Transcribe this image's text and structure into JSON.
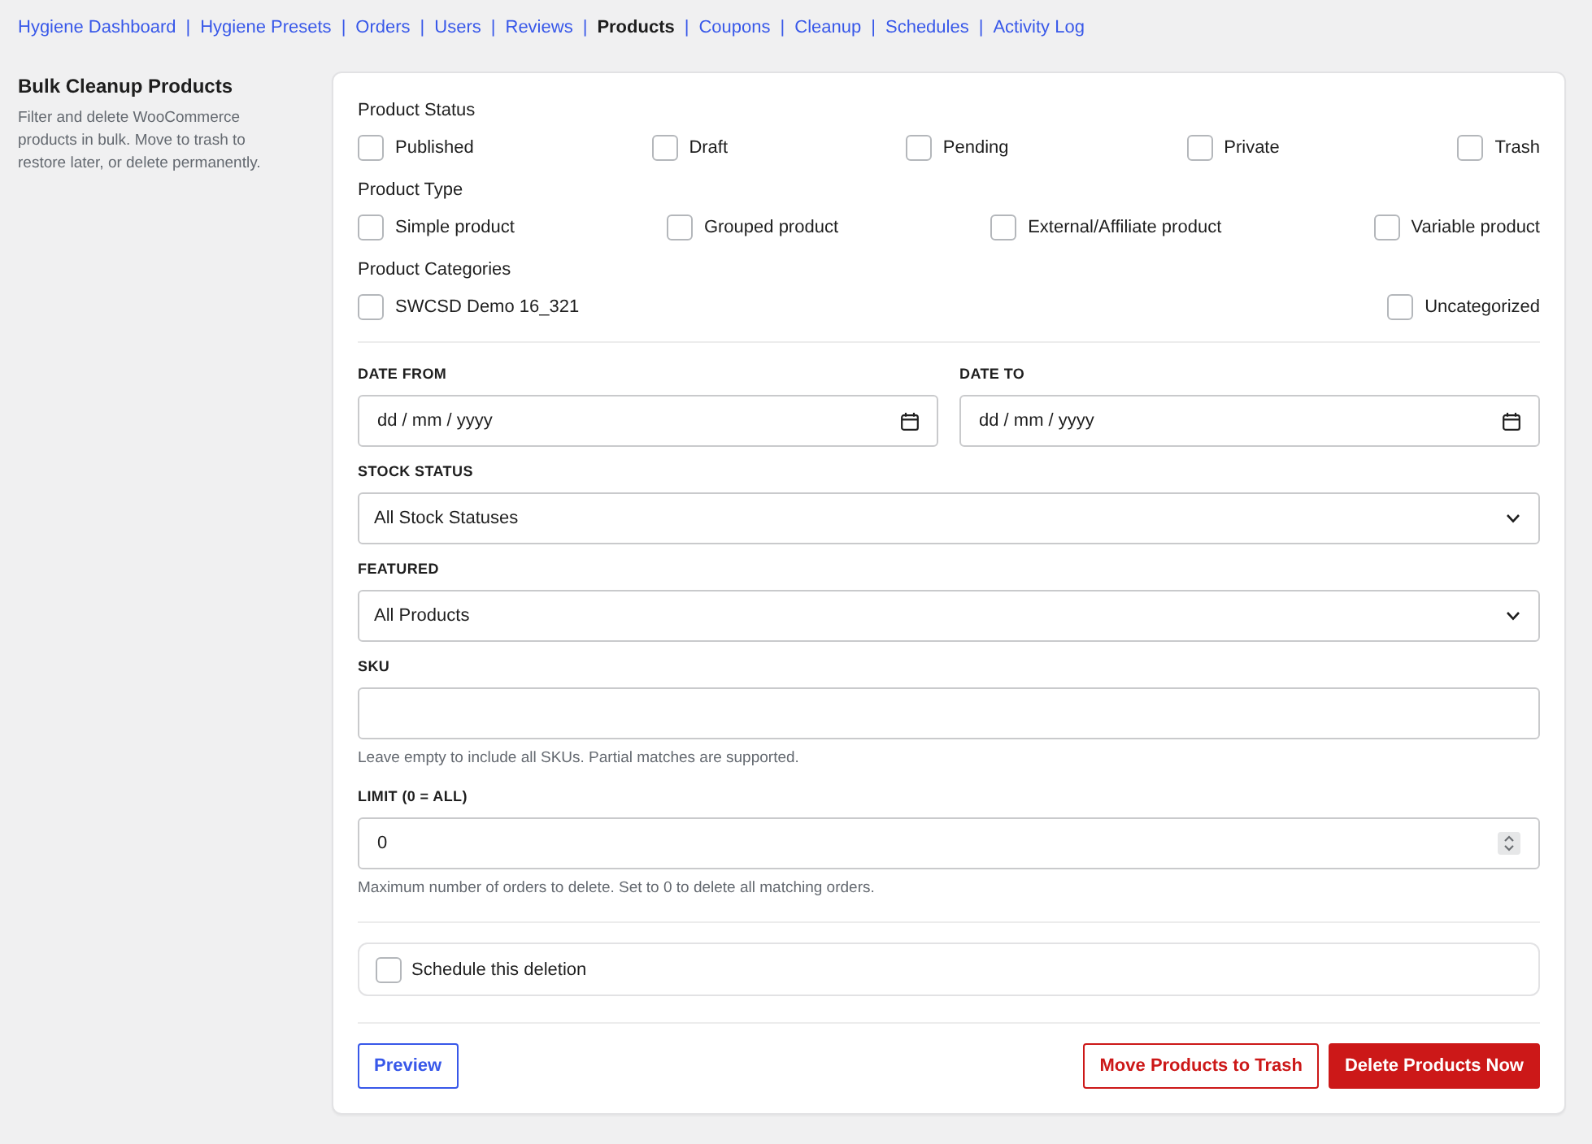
{
  "nav": {
    "separator": "|",
    "items": [
      {
        "label": "Hygiene Dashboard",
        "selected": false
      },
      {
        "label": "Hygiene Presets",
        "selected": false
      },
      {
        "label": "Orders",
        "selected": false
      },
      {
        "label": "Users",
        "selected": false
      },
      {
        "label": "Reviews",
        "selected": false
      },
      {
        "label": "Products",
        "selected": true
      },
      {
        "label": "Coupons",
        "selected": false
      },
      {
        "label": "Cleanup",
        "selected": false
      },
      {
        "label": "Schedules",
        "selected": false
      },
      {
        "label": "Activity Log",
        "selected": false
      }
    ]
  },
  "sidebar": {
    "title": "Bulk Cleanup Products",
    "description": "Filter and delete WooCommerce products in bulk. Move to trash to restore later, or delete permanently."
  },
  "filters": [
    {
      "label": "Product Status",
      "options": [
        {
          "label": "Published",
          "checked": false
        },
        {
          "label": "Draft",
          "checked": false
        },
        {
          "label": "Pending",
          "checked": false
        },
        {
          "label": "Private",
          "checked": false
        },
        {
          "label": "Trash",
          "checked": false
        }
      ]
    },
    {
      "label": "Product Type",
      "options": [
        {
          "label": "Simple product",
          "checked": false
        },
        {
          "label": "Grouped product",
          "checked": false
        },
        {
          "label": "External/Affiliate product",
          "checked": false
        },
        {
          "label": "Variable product",
          "checked": false
        }
      ]
    },
    {
      "label": "Product Categories",
      "options": [
        {
          "label": "SWCSD Demo 16_321",
          "checked": false
        },
        {
          "label": "Uncategorized",
          "checked": false
        }
      ]
    }
  ],
  "date_range": [
    {
      "label": "DATE FROM",
      "placeholder": "dd / mm / yyyy"
    },
    {
      "label": "DATE TO",
      "placeholder": "dd / mm / yyyy"
    }
  ],
  "selects": [
    {
      "label": "STOCK STATUS",
      "value": "All Stock Statuses"
    },
    {
      "label": "FEATURED",
      "value": "All Products"
    }
  ],
  "sku": {
    "label": "SKU",
    "help": "Leave empty to include all SKUs. Partial matches are supported."
  },
  "limit": {
    "label": "LIMIT (0 = ALL)",
    "value": "0",
    "help": "Maximum number of orders to delete. Set to 0 to delete all matching orders."
  },
  "schedule": {
    "label": "Schedule this deletion",
    "checked": false
  },
  "actions": {
    "left": [
      {
        "label": "Preview",
        "kind": "outline"
      }
    ],
    "right": [
      {
        "label": "Move Products to Trash",
        "kind": "danger-outline"
      },
      {
        "label": "Delete Products Now",
        "kind": "danger"
      }
    ]
  }
}
